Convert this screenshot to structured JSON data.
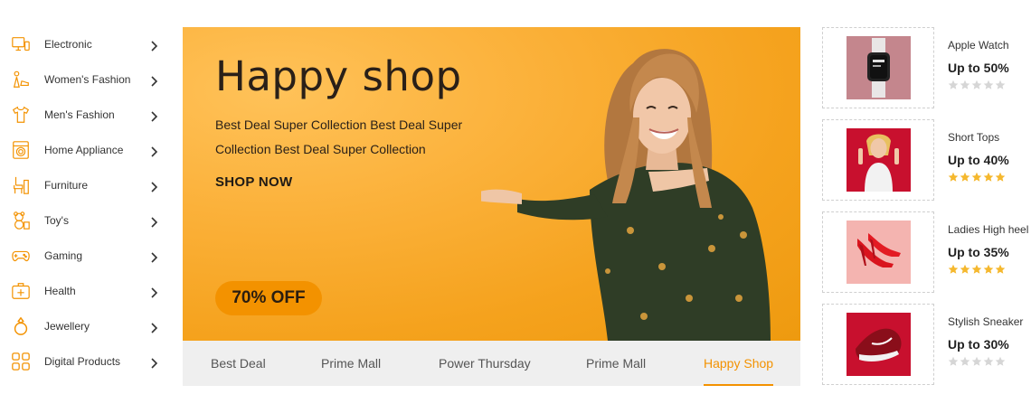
{
  "sidebar": {
    "items": [
      {
        "label": "Electronic",
        "icon": "electronics-icon"
      },
      {
        "label": "Women's Fashion",
        "icon": "womens-fashion-icon"
      },
      {
        "label": "Men's Fashion",
        "icon": "tshirt-icon"
      },
      {
        "label": "Home Appliance",
        "icon": "washing-machine-icon"
      },
      {
        "label": "Furniture",
        "icon": "furniture-icon"
      },
      {
        "label": "Toy's",
        "icon": "teddy-bear-icon"
      },
      {
        "label": "Gaming",
        "icon": "gamepad-icon"
      },
      {
        "label": "Health",
        "icon": "first-aid-icon"
      },
      {
        "label": "Jewellery",
        "icon": "ring-icon"
      },
      {
        "label": "Digital Products",
        "icon": "grid-apps-icon"
      }
    ]
  },
  "banner": {
    "title": "Happy shop",
    "description": "Best Deal Super Collection Best Deal Super Collection Best Deal Super Collection",
    "cta": "SHOP NOW",
    "badge": "70% OFF"
  },
  "tabs": [
    {
      "label": "Best Deal",
      "active": false
    },
    {
      "label": "Prime Mall",
      "active": false
    },
    {
      "label": "Power Thursday",
      "active": false
    },
    {
      "label": "Prime Mall",
      "active": false
    },
    {
      "label": "Happy Shop",
      "active": true
    }
  ],
  "products": [
    {
      "name": "Apple Watch",
      "discount": "Up to 50%",
      "rating": 0
    },
    {
      "name": "Short Tops",
      "discount": "Up to 40%",
      "rating": 5
    },
    {
      "name": "Ladies High heel",
      "discount": "Up to 35%",
      "rating": 5
    },
    {
      "name": "Stylish Sneaker",
      "discount": "Up to 30%",
      "rating": 0
    }
  ],
  "colors": {
    "accent": "#f39200",
    "banner_bg": "#f5a21d",
    "star_filled": "#f5b82e",
    "star_empty": "#d6d6d6",
    "tab_bg": "#efefef"
  }
}
